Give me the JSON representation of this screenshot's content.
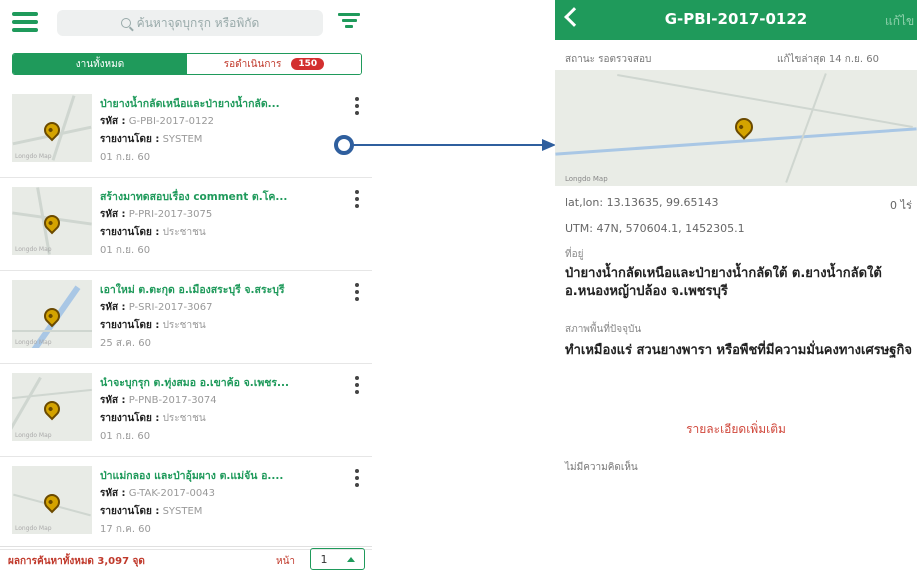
{
  "left": {
    "search_placeholder": "ค้นหาจุดบุกรุก หรือพิกัด",
    "tabs": {
      "all_label": "งานทั้งหมด",
      "pending_label": "รอดำเนินการ",
      "pending_count": "150"
    },
    "code_label": "รหัส :",
    "reporter_label": "รายงานโดย :",
    "items": [
      {
        "title": "ป่ายางน้ำกลัดเหนือและป่ายางน้ำกลัด...",
        "code": "G-PBI-2017-0122",
        "reporter": "SYSTEM",
        "date": "01 ก.ย. 60"
      },
      {
        "title": "สร้างมาทดสอบเรื่อง comment ต.โค...",
        "code": "P-PRI-2017-3075",
        "reporter": "ประชาชน",
        "date": "01 ก.ย. 60"
      },
      {
        "title": "เอาใหม่ ต.ตะกุด อ.เมืองสระบุรี จ.สระบุรี",
        "code": "P-SRI-2017-3067",
        "reporter": "ประชาชน",
        "date": "25 ส.ค. 60"
      },
      {
        "title": "นำจะบุกรุก ต.ทุ่งสมอ อ.เขาค้อ จ.เพชร...",
        "code": "P-PNB-2017-3074",
        "reporter": "ประชาชน",
        "date": "01 ก.ย. 60"
      },
      {
        "title": "ป่าแม่กลอง และป่าอุ้มผาง ต.แม่จัน อ....",
        "code": "G-TAK-2017-0043",
        "reporter": "SYSTEM",
        "date": "17 ก.ค. 60"
      }
    ],
    "footer": {
      "total": "ผลการค้นหาทั้งหมด 3,097 จุด",
      "page_label": "หน้า",
      "page": "1"
    },
    "map_attribution": "Longdo Map"
  },
  "right": {
    "title": "G-PBI-2017-0122",
    "edit_label": "แก้ไข",
    "status": "สถานะ รอตรวจสอบ",
    "updated": "แก้ไขล่าสุด 14 ก.ย. 60",
    "map_attribution": "Longdo Map",
    "latlon": "lat,lon: 13.13635, 99.65143",
    "area": "0 ไร่",
    "utm": "UTM: 47N, 570604.1, 1452305.1",
    "address_label": "ที่อยู่",
    "address": "ป่ายางน้ำกลัดเหนือและป่ายางน้ำกลัดใต้ ต.ยางน้ำกลัดใต้ อ.หนองหญ้าปล้อง จ.เพชรบุรี",
    "condition_label": "สภาพพื้นที่ปัจจุบัน",
    "condition": "ทำเหมืองแร่ สวนยางพารา หรือพืชที่มีความมั่นคงทางเศรษฐกิจ",
    "more_label": "รายละเอียดเพิ่มเติม",
    "no_comment": "ไม่มีความคิดเห็น"
  },
  "colors": {
    "brand_green": "#1f9a5b",
    "badge_red": "#d32f2f",
    "link_red": "#d0473b",
    "arrow_blue": "#2f5f9e"
  }
}
